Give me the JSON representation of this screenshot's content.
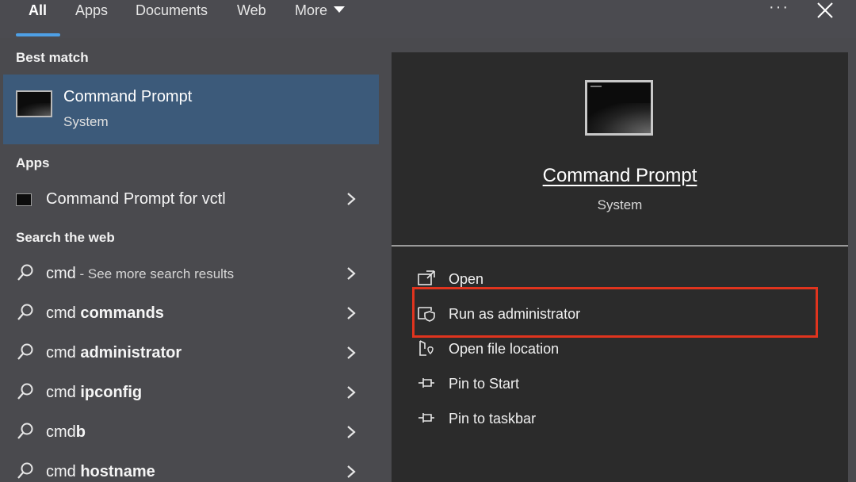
{
  "tabs": [
    {
      "label": "All"
    },
    {
      "label": "Apps"
    },
    {
      "label": "Documents"
    },
    {
      "label": "Web"
    },
    {
      "label": "More"
    }
  ],
  "topbar": {
    "more_options_label": "···"
  },
  "left": {
    "best_match_title": "Best match",
    "best_match": {
      "title": "Command Prompt",
      "subtitle": "System",
      "icon": "command-prompt-icon"
    },
    "apps_title": "Apps",
    "apps": [
      {
        "label": "Command Prompt for vctl",
        "icon": "command-prompt-icon"
      }
    ],
    "web_title": "Search the web",
    "web_results": [
      {
        "prefix": "cmd",
        "bold": "",
        "suffix": " - See more search results"
      },
      {
        "prefix": "cmd ",
        "bold": "commands",
        "suffix": ""
      },
      {
        "prefix": "cmd ",
        "bold": "administrator",
        "suffix": ""
      },
      {
        "prefix": "cmd ",
        "bold": "ipconfig",
        "suffix": ""
      },
      {
        "prefix": "cmd",
        "bold": "b",
        "suffix": ""
      },
      {
        "prefix": "cmd ",
        "bold": "hostname",
        "suffix": ""
      }
    ]
  },
  "right": {
    "title": "Command Prompt",
    "subtitle": "System",
    "actions": [
      {
        "label": "Open",
        "icon": "open-icon"
      },
      {
        "label": "Run as administrator",
        "icon": "shield-window-icon"
      },
      {
        "label": "Open file location",
        "icon": "folder-location-icon"
      },
      {
        "label": "Pin to Start",
        "icon": "pin-icon"
      },
      {
        "label": "Pin to taskbar",
        "icon": "pin-icon"
      }
    ]
  },
  "colors": {
    "accent": "#4ea0e6",
    "selected_bg": "#3c5a7a",
    "highlight_border": "#e0341e",
    "panel_bg": "#2b2b2b",
    "base_bg": "#4a4a4e"
  }
}
